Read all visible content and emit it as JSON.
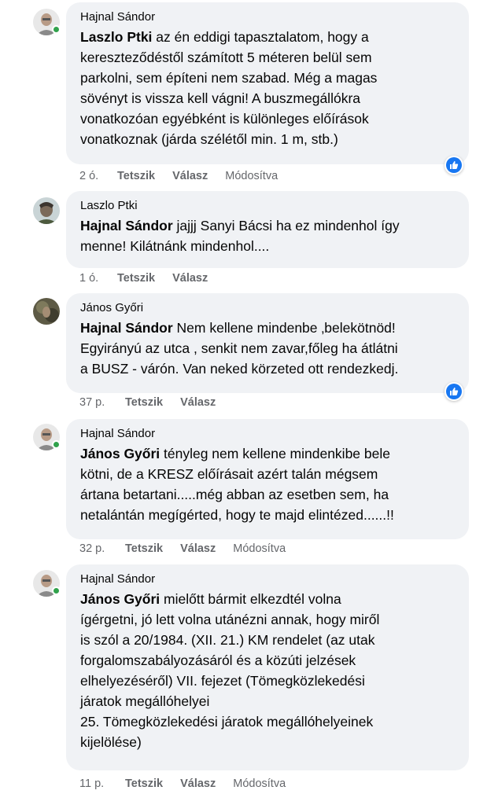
{
  "comments": [
    {
      "author": "Hajnal Sándor",
      "mention": "Laszlo Ptki",
      "text": " az én eddigi tapasztalatom, hogy a\nkereszteződéstől számított 5 méteren belül sem\nparkolni, sem építeni nem szabad. Még a magas\nsövényt is vissza kell vágni! A buszmegállókra\nvonatkozóan egyébként is különleges előírások\nvonatkoznak (járda szélétől min. 1 m, stb.)",
      "time": "2 ó.",
      "like_label": "Tetszik",
      "reply_label": "Válasz",
      "edited_label": "Módosítva",
      "reaction_icon": "like-reaction-icon"
    },
    {
      "author": "Laszlo Ptki",
      "mention": "Hajnal Sándor",
      "text": " jajjj Sanyi Bácsi ha ez mindenhol így\nmenne! Kilátnánk mindenhol....",
      "time": "1 ó.",
      "like_label": "Tetszik",
      "reply_label": "Válasz",
      "edited_label": ""
    },
    {
      "author": "János Győri",
      "mention": "Hajnal Sándor",
      "text": " Nem kellene mindenbe ‚belekötnöd!\nEgyirányú az utca , senkit nem zavar,főleg ha átlátni\na BUSZ - várón. Van neked körzeted ott rendezkedj.",
      "time": "37 p.",
      "like_label": "Tetszik",
      "reply_label": "Válasz",
      "edited_label": "",
      "reaction_icon": "like-reaction-icon"
    },
    {
      "author": "Hajnal Sándor",
      "mention": "János Győri",
      "text": " tényleg nem kellene mindenkibe bele\nkötni, de a KRESZ előírásait azért talán mégsem\nártana betartani.....még abban az esetben sem, ha\nnetalántán megígérted, hogy te majd elintézed......!!",
      "time": "32 p.",
      "like_label": "Tetszik",
      "reply_label": "Válasz",
      "edited_label": "Módosítva"
    },
    {
      "author": "Hajnal Sándor",
      "mention": "János Győri",
      "text": " mielőtt bármit elkezdtél volna\nígérgetni, jó lett volna utánézni annak, hogy miről\nis szól a 20/1984. (XII. 21.) KM rendelet (az utak\nforgalomszabályozásáról és a közúti jelzések\nelhelyezéséről) VII. fejezet (Tömegközlekedési\njáratok megállóhelyei\n25. Tömegközlekedési járatok megállóhelyeinek\nkijelölése)",
      "time": "11 p.",
      "like_label": "Tetszik",
      "reply_label": "Válasz",
      "edited_label": "Módosítva"
    }
  ],
  "colors": {
    "bubble": "#f0f2f5",
    "meta": "#65676b",
    "like_blue": "#1877f2",
    "online": "#31a24c"
  }
}
